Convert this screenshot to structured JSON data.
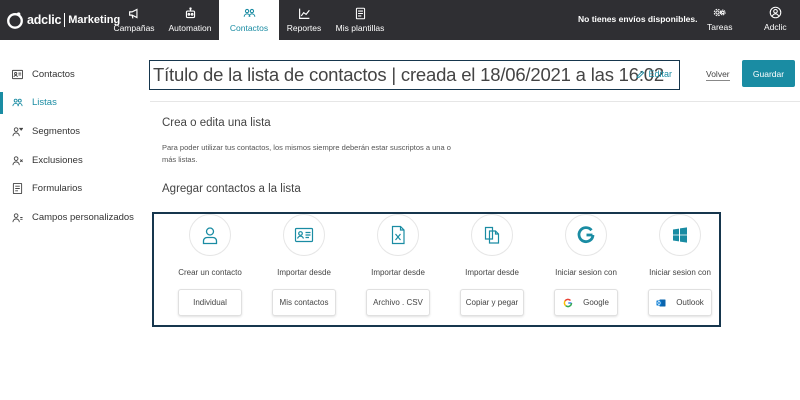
{
  "brand": {
    "name": "adclic",
    "sub": "Marketing"
  },
  "nav": [
    {
      "label": "Campañas",
      "icon": "megaphone-icon"
    },
    {
      "label": "Automation",
      "icon": "robot-icon"
    },
    {
      "label": "Contactos",
      "icon": "contacts-icon",
      "active": true
    },
    {
      "label": "Reportes",
      "icon": "chart-icon"
    },
    {
      "label": "Mis plantillas",
      "icon": "template-icon"
    }
  ],
  "notice": "No tienes envíos disponibles.",
  "tasks_label": "Tareas",
  "user_label": "Adclic",
  "sidebar": [
    {
      "label": "Contactos",
      "icon": "contact-card-icon"
    },
    {
      "label": "Listas",
      "icon": "users-icon",
      "active": true
    },
    {
      "label": "Segmentos",
      "icon": "segment-icon"
    },
    {
      "label": "Exclusiones",
      "icon": "user-x-icon"
    },
    {
      "label": "Formularios",
      "icon": "form-icon"
    },
    {
      "label": "Campos personalizados",
      "icon": "user-fields-icon"
    }
  ],
  "header": {
    "title": "Título de la lista de contactos | creada el 18/06/2021 a las 16:02",
    "edit_label": "Editar",
    "back_label": "Volver",
    "save_label": "Guardar"
  },
  "section": {
    "title": "Crea o edita una lista",
    "description": "Para poder utilizar tus contactos, los mismos siempre deberán estar suscriptos a una o más listas.",
    "add_title": "Agregar contactos a la lista"
  },
  "options": [
    {
      "label": "Crear un contacto",
      "button": "Individual",
      "icon": "user-icon"
    },
    {
      "label": "Importar desde",
      "button": "Mis contactos",
      "icon": "id-card-icon"
    },
    {
      "label": "Importar desde",
      "button": "Archivo . CSV",
      "icon": "excel-file-icon"
    },
    {
      "label": "Importar desde",
      "button": "Copiar y pegar",
      "icon": "copy-icon"
    },
    {
      "label": "Iniciar sesion con",
      "button": "Google",
      "icon": "google-icon"
    },
    {
      "label": "Iniciar sesion con",
      "button": "Outlook",
      "icon": "windows-icon"
    }
  ],
  "colors": {
    "accent": "#1a8ca3",
    "topbar": "#2f2f33",
    "border": "#16364d"
  }
}
